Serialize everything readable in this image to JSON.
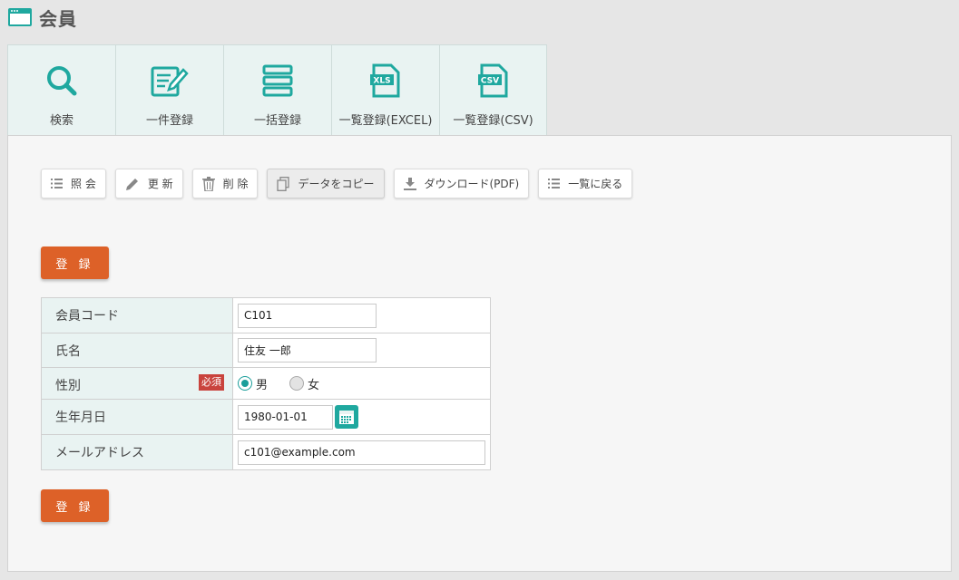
{
  "header": {
    "title": "会員",
    "icon": "window-icon"
  },
  "tabs": [
    {
      "label": "検索",
      "icon": "search-icon"
    },
    {
      "label": "一件登録",
      "icon": "edit-form-icon"
    },
    {
      "label": "一括登録",
      "icon": "list-stack-icon"
    },
    {
      "label": "一覧登録(EXCEL)",
      "icon": "xls-file-icon",
      "badge": "XLS"
    },
    {
      "label": "一覧登録(CSV)",
      "icon": "csv-file-icon",
      "badge": "CSV"
    }
  ],
  "toolbar": {
    "view": "照 会",
    "update": "更 新",
    "delete": "削 除",
    "copy": "データをコピー",
    "download": "ダウンロード(PDF)",
    "back": "一覧に戻る"
  },
  "submit_label": "登 録",
  "form": {
    "code": {
      "label": "会員コード",
      "value": "C101"
    },
    "name": {
      "label": "氏名",
      "value": "住友 一郎"
    },
    "gender": {
      "label": "性別",
      "required": "必須",
      "options": [
        "男",
        "女"
      ],
      "selected": "男"
    },
    "birth": {
      "label": "生年月日",
      "value": "1980-01-01"
    },
    "email": {
      "label": "メールアドレス",
      "value": "c101@example.com"
    }
  },
  "colors": {
    "accent": "#1fa89f",
    "submit": "#dd6128",
    "required": "#c9433d",
    "tab_bg": "#e9f3f2"
  }
}
